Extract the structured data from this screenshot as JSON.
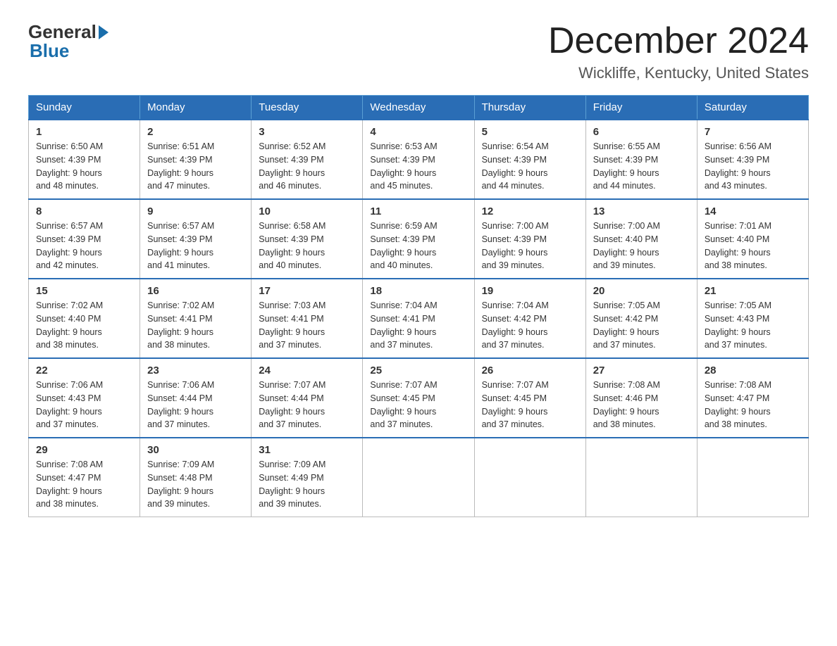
{
  "header": {
    "logo_general": "General",
    "logo_blue": "Blue",
    "month_title": "December 2024",
    "location": "Wickliffe, Kentucky, United States"
  },
  "weekdays": [
    "Sunday",
    "Monday",
    "Tuesday",
    "Wednesday",
    "Thursday",
    "Friday",
    "Saturday"
  ],
  "weeks": [
    [
      {
        "day": "1",
        "sunrise": "6:50 AM",
        "sunset": "4:39 PM",
        "daylight": "9 hours and 48 minutes."
      },
      {
        "day": "2",
        "sunrise": "6:51 AM",
        "sunset": "4:39 PM",
        "daylight": "9 hours and 47 minutes."
      },
      {
        "day": "3",
        "sunrise": "6:52 AM",
        "sunset": "4:39 PM",
        "daylight": "9 hours and 46 minutes."
      },
      {
        "day": "4",
        "sunrise": "6:53 AM",
        "sunset": "4:39 PM",
        "daylight": "9 hours and 45 minutes."
      },
      {
        "day": "5",
        "sunrise": "6:54 AM",
        "sunset": "4:39 PM",
        "daylight": "9 hours and 44 minutes."
      },
      {
        "day": "6",
        "sunrise": "6:55 AM",
        "sunset": "4:39 PM",
        "daylight": "9 hours and 44 minutes."
      },
      {
        "day": "7",
        "sunrise": "6:56 AM",
        "sunset": "4:39 PM",
        "daylight": "9 hours and 43 minutes."
      }
    ],
    [
      {
        "day": "8",
        "sunrise": "6:57 AM",
        "sunset": "4:39 PM",
        "daylight": "9 hours and 42 minutes."
      },
      {
        "day": "9",
        "sunrise": "6:57 AM",
        "sunset": "4:39 PM",
        "daylight": "9 hours and 41 minutes."
      },
      {
        "day": "10",
        "sunrise": "6:58 AM",
        "sunset": "4:39 PM",
        "daylight": "9 hours and 40 minutes."
      },
      {
        "day": "11",
        "sunrise": "6:59 AM",
        "sunset": "4:39 PM",
        "daylight": "9 hours and 40 minutes."
      },
      {
        "day": "12",
        "sunrise": "7:00 AM",
        "sunset": "4:39 PM",
        "daylight": "9 hours and 39 minutes."
      },
      {
        "day": "13",
        "sunrise": "7:00 AM",
        "sunset": "4:40 PM",
        "daylight": "9 hours and 39 minutes."
      },
      {
        "day": "14",
        "sunrise": "7:01 AM",
        "sunset": "4:40 PM",
        "daylight": "9 hours and 38 minutes."
      }
    ],
    [
      {
        "day": "15",
        "sunrise": "7:02 AM",
        "sunset": "4:40 PM",
        "daylight": "9 hours and 38 minutes."
      },
      {
        "day": "16",
        "sunrise": "7:02 AM",
        "sunset": "4:41 PM",
        "daylight": "9 hours and 38 minutes."
      },
      {
        "day": "17",
        "sunrise": "7:03 AM",
        "sunset": "4:41 PM",
        "daylight": "9 hours and 37 minutes."
      },
      {
        "day": "18",
        "sunrise": "7:04 AM",
        "sunset": "4:41 PM",
        "daylight": "9 hours and 37 minutes."
      },
      {
        "day": "19",
        "sunrise": "7:04 AM",
        "sunset": "4:42 PM",
        "daylight": "9 hours and 37 minutes."
      },
      {
        "day": "20",
        "sunrise": "7:05 AM",
        "sunset": "4:42 PM",
        "daylight": "9 hours and 37 minutes."
      },
      {
        "day": "21",
        "sunrise": "7:05 AM",
        "sunset": "4:43 PM",
        "daylight": "9 hours and 37 minutes."
      }
    ],
    [
      {
        "day": "22",
        "sunrise": "7:06 AM",
        "sunset": "4:43 PM",
        "daylight": "9 hours and 37 minutes."
      },
      {
        "day": "23",
        "sunrise": "7:06 AM",
        "sunset": "4:44 PM",
        "daylight": "9 hours and 37 minutes."
      },
      {
        "day": "24",
        "sunrise": "7:07 AM",
        "sunset": "4:44 PM",
        "daylight": "9 hours and 37 minutes."
      },
      {
        "day": "25",
        "sunrise": "7:07 AM",
        "sunset": "4:45 PM",
        "daylight": "9 hours and 37 minutes."
      },
      {
        "day": "26",
        "sunrise": "7:07 AM",
        "sunset": "4:45 PM",
        "daylight": "9 hours and 37 minutes."
      },
      {
        "day": "27",
        "sunrise": "7:08 AM",
        "sunset": "4:46 PM",
        "daylight": "9 hours and 38 minutes."
      },
      {
        "day": "28",
        "sunrise": "7:08 AM",
        "sunset": "4:47 PM",
        "daylight": "9 hours and 38 minutes."
      }
    ],
    [
      {
        "day": "29",
        "sunrise": "7:08 AM",
        "sunset": "4:47 PM",
        "daylight": "9 hours and 38 minutes."
      },
      {
        "day": "30",
        "sunrise": "7:09 AM",
        "sunset": "4:48 PM",
        "daylight": "9 hours and 39 minutes."
      },
      {
        "day": "31",
        "sunrise": "7:09 AM",
        "sunset": "4:49 PM",
        "daylight": "9 hours and 39 minutes."
      },
      null,
      null,
      null,
      null
    ]
  ],
  "labels": {
    "sunrise": "Sunrise:",
    "sunset": "Sunset:",
    "daylight": "Daylight:"
  }
}
